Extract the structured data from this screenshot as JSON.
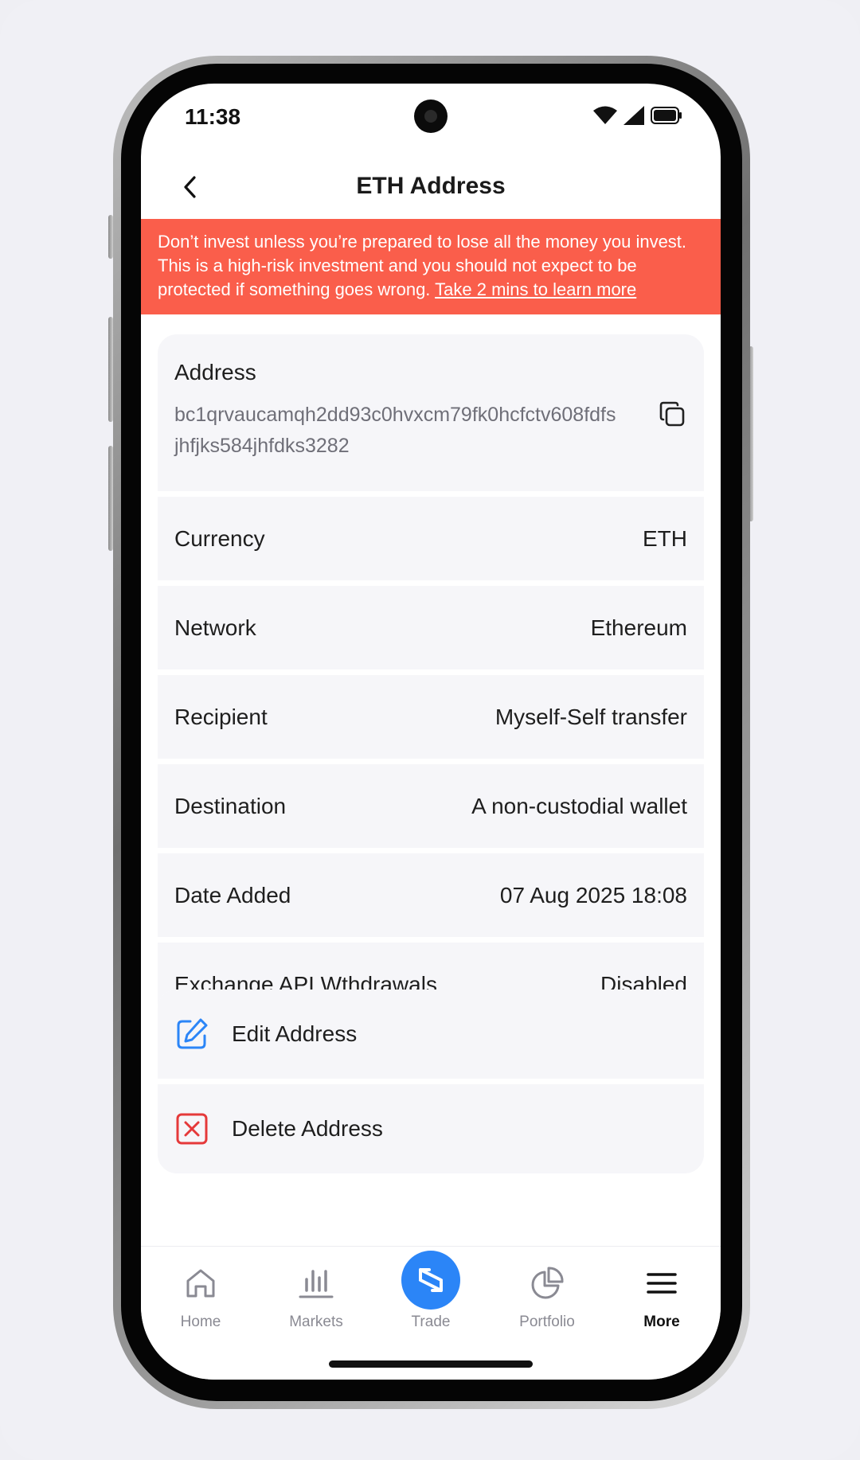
{
  "status_bar": {
    "time": "11:38"
  },
  "header": {
    "title": "ETH Address"
  },
  "risk_banner": {
    "text": "Don’t invest unless you’re prepared to lose all the money you invest. This is a high-risk investment and you should not expect to be protected if something goes wrong. ",
    "link_text": "Take 2 mins to learn more"
  },
  "address": {
    "label": "Address",
    "value": "bc1qrvaucamqh2dd93c0hvxcm79fk0hcfctv608fdfsjhfjks584jhfdks3282"
  },
  "details": [
    {
      "label": "Currency",
      "value": "ETH"
    },
    {
      "label": "Network",
      "value": "Ethereum"
    },
    {
      "label": "Recipient",
      "value": "Myself-Self transfer"
    },
    {
      "label": "Destination",
      "value": "A non-custodial wallet"
    },
    {
      "label": "Date Added",
      "value": "07 Aug 2025 18:08"
    },
    {
      "label": "Exchange API Wthdrawals",
      "value": "Disabled"
    }
  ],
  "actions": {
    "edit_label": "Edit Address",
    "delete_label": "Delete Address"
  },
  "nav": {
    "items": [
      {
        "label": "Home",
        "icon": "home-icon"
      },
      {
        "label": "Markets",
        "icon": "bar-chart-icon"
      },
      {
        "label": "Trade",
        "icon": "swap-arrows-icon"
      },
      {
        "label": "Portfolio",
        "icon": "pie-chart-icon"
      },
      {
        "label": "More",
        "icon": "menu-icon"
      }
    ],
    "active": "More"
  },
  "colors": {
    "banner": "#fa5e4b",
    "accent_blue": "#2b85f7",
    "delete_red": "#e5393a",
    "row_bg": "#f6f6f9"
  }
}
